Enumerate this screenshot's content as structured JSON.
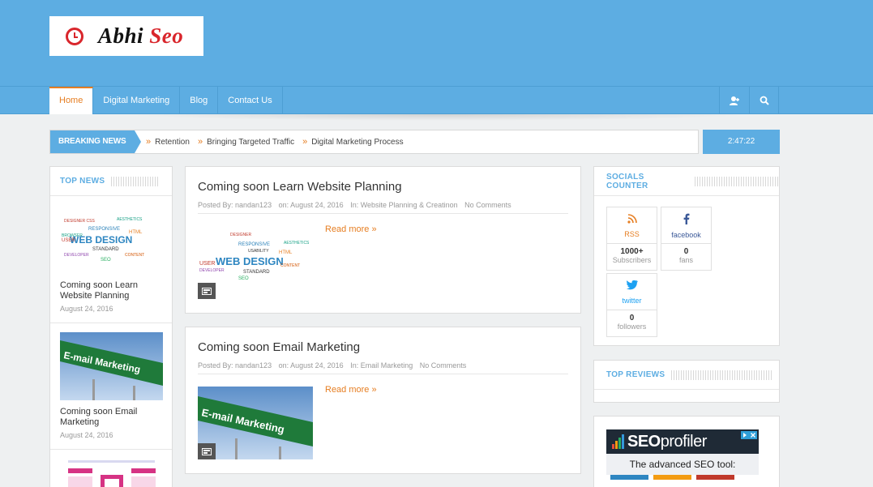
{
  "site": {
    "logo_prefix": "Abhi",
    "logo_suffix": "Seo",
    "brand_color": "#5dade2",
    "accent": "#e67e22"
  },
  "nav": {
    "items": [
      {
        "label": "Home",
        "active": true
      },
      {
        "label": "Digital Marketing",
        "active": false
      },
      {
        "label": "Blog",
        "active": false
      },
      {
        "label": "Contact Us",
        "active": false
      }
    ],
    "icons": [
      "user-icon",
      "search-icon"
    ]
  },
  "breaking": {
    "label": "BREAKING NEWS",
    "items": [
      "Retention",
      "Bringing Targeted Traffic",
      "Digital Marketing Process"
    ],
    "time": "2:47:22"
  },
  "top_news": {
    "title": "TOP NEWS",
    "items": [
      {
        "title": "Coming soon Learn Website Planning",
        "date": "August 24, 2016",
        "thumb": "web-design-wordcloud"
      },
      {
        "title": "Coming soon Email Marketing",
        "date": "August 24, 2016",
        "thumb": "email-marketing-sign"
      },
      {
        "title": "",
        "date": "",
        "thumb": "review-improve-analytics"
      }
    ]
  },
  "posts": [
    {
      "title": "Coming soon Learn Website Planning",
      "author": "Posted By: nandan123",
      "date": "on: August 24, 2016",
      "category": "In: Website Planning & Creatinon",
      "comments": "No Comments",
      "read_more": "Read more »",
      "thumb": "web-design-wordcloud"
    },
    {
      "title": "Coming soon Email Marketing",
      "author": "Posted By: nandan123",
      "date": "on: August 24, 2016",
      "category": "In: Email Marketing",
      "comments": "No Comments",
      "read_more": "Read more »",
      "thumb": "email-marketing-sign"
    }
  ],
  "socials": {
    "title": "SOCIALS COUNTER",
    "rss": {
      "label": "RSS",
      "count": "1000+",
      "unit": "Subscribers",
      "color": "#e67e22"
    },
    "facebook": {
      "label": "facebook",
      "count": "0",
      "unit": "fans",
      "color": "#3b5998"
    },
    "twitter": {
      "label": "twitter",
      "count": "0",
      "unit": "followers",
      "color": "#1da1f2"
    }
  },
  "top_reviews": {
    "title": "TOP REVIEWS"
  },
  "ad": {
    "brand_prefix": "SEO",
    "brand_suffix": "profiler",
    "tagline": "The advanced SEO tool:"
  }
}
